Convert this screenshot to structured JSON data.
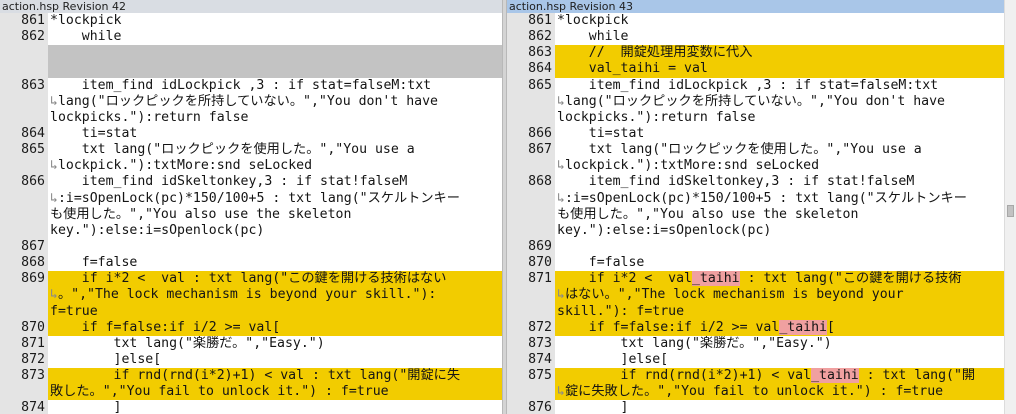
{
  "left_pane": {
    "title": "action.hsp Revision 42",
    "lines": [
      {
        "num": "861",
        "text": "*lockpick",
        "wrap": false,
        "hl": false,
        "gap": false
      },
      {
        "num": "862",
        "text": "    while",
        "wrap": false,
        "hl": false,
        "gap": false
      },
      {
        "num": "",
        "text": "",
        "wrap": false,
        "hl": false,
        "gap": true
      },
      {
        "num": "",
        "text": "",
        "wrap": false,
        "hl": false,
        "gap": true
      },
      {
        "num": "863",
        "text": "    item_find idLockpick ,3 : if stat=falseM:txt",
        "wrap": false,
        "hl": false,
        "gap": false
      },
      {
        "num": "",
        "text": "lang(\"ロックピックを所持していない。\",\"You don't have",
        "wrap": true,
        "hl": false,
        "gap": false
      },
      {
        "num": "",
        "text": "lockpicks.\"):return false",
        "wrap": false,
        "hl": false,
        "gap": false
      },
      {
        "num": "864",
        "text": "    ti=stat",
        "wrap": false,
        "hl": false,
        "gap": false
      },
      {
        "num": "865",
        "text": "    txt lang(\"ロックピックを使用した。\",\"You use a",
        "wrap": false,
        "hl": false,
        "gap": false
      },
      {
        "num": "",
        "text": "lockpick.\"):txtMore:snd seLocked",
        "wrap": true,
        "hl": false,
        "gap": false
      },
      {
        "num": "866",
        "text": "    item_find idSkeltonkey,3 : if stat!falseM",
        "wrap": false,
        "hl": false,
        "gap": false
      },
      {
        "num": "",
        "text": ":i=sOpenLock(pc)*150/100+5 : txt lang(\"スケルトンキー",
        "wrap": true,
        "hl": false,
        "gap": false
      },
      {
        "num": "",
        "text": "も使用した。\",\"You also use the skeleton",
        "wrap": false,
        "hl": false,
        "gap": false
      },
      {
        "num": "",
        "text": "key.\"):else:i=sOpenlock(pc)",
        "wrap": false,
        "hl": false,
        "gap": false
      },
      {
        "num": "867",
        "text": "",
        "wrap": false,
        "hl": false,
        "gap": false
      },
      {
        "num": "868",
        "text": "    f=false",
        "wrap": false,
        "hl": false,
        "gap": false
      },
      {
        "num": "869",
        "text": "    if i*2 <  val : txt lang(\"この鍵を開ける技術はない",
        "wrap": false,
        "hl": true,
        "gap": false
      },
      {
        "num": "",
        "text": "。\",\"The lock mechanism is beyond your skill.\"):",
        "wrap": true,
        "hl": true,
        "gap": false
      },
      {
        "num": "",
        "text": "f=true",
        "wrap": false,
        "hl": true,
        "gap": false
      },
      {
        "num": "870",
        "text": "    if f=false:if i/2 >= val[",
        "wrap": false,
        "hl": true,
        "gap": false
      },
      {
        "num": "871",
        "text": "        txt lang(\"楽勝だ。\",\"Easy.\")",
        "wrap": false,
        "hl": false,
        "gap": false
      },
      {
        "num": "872",
        "text": "        ]else[",
        "wrap": false,
        "hl": false,
        "gap": false
      },
      {
        "num": "873",
        "text": "        if rnd(rnd(i*2)+1) < val : txt lang(\"開錠に失",
        "wrap": false,
        "hl": true,
        "gap": false
      },
      {
        "num": "",
        "text": "敗した。\",\"You fail to unlock it.\") : f=true",
        "wrap": false,
        "hl": true,
        "gap": false
      },
      {
        "num": "874",
        "text": "        ]",
        "wrap": false,
        "hl": false,
        "gap": false
      }
    ]
  },
  "right_pane": {
    "title": "action.hsp Revision 43",
    "lines": [
      {
        "num": "861",
        "text": "*lockpick",
        "wrap": false,
        "hl": false,
        "gap": false
      },
      {
        "num": "862",
        "text": "    while",
        "wrap": false,
        "hl": false,
        "gap": false
      },
      {
        "num": "863",
        "text": "    //  開錠処理用変数に代入",
        "wrap": false,
        "hl": true,
        "gap": false
      },
      {
        "num": "864",
        "text": "    val_taihi = val",
        "wrap": false,
        "hl": true,
        "gap": false
      },
      {
        "num": "865",
        "text": "    item_find idLockpick ,3 : if stat=falseM:txt",
        "wrap": false,
        "hl": false,
        "gap": false
      },
      {
        "num": "",
        "text": "lang(\"ロックピックを所持していない。\",\"You don't have",
        "wrap": true,
        "hl": false,
        "gap": false
      },
      {
        "num": "",
        "text": "lockpicks.\"):return false",
        "wrap": false,
        "hl": false,
        "gap": false
      },
      {
        "num": "866",
        "text": "    ti=stat",
        "wrap": false,
        "hl": false,
        "gap": false
      },
      {
        "num": "867",
        "text": "    txt lang(\"ロックピックを使用した。\",\"You use a",
        "wrap": false,
        "hl": false,
        "gap": false
      },
      {
        "num": "",
        "text": "lockpick.\"):txtMore:snd seLocked",
        "wrap": true,
        "hl": false,
        "gap": false
      },
      {
        "num": "868",
        "text": "    item_find idSkeltonkey,3 : if stat!falseM",
        "wrap": false,
        "hl": false,
        "gap": false
      },
      {
        "num": "",
        "text": ":i=sOpenLock(pc)*150/100+5 : txt lang(\"スケルトンキー",
        "wrap": true,
        "hl": false,
        "gap": false
      },
      {
        "num": "",
        "text": "も使用した。\",\"You also use the skeleton",
        "wrap": false,
        "hl": false,
        "gap": false
      },
      {
        "num": "",
        "text": "key.\"):else:i=sOpenlock(pc)",
        "wrap": false,
        "hl": false,
        "gap": false
      },
      {
        "num": "869",
        "text": "",
        "wrap": false,
        "hl": false,
        "gap": false
      },
      {
        "num": "870",
        "text": "    f=false",
        "wrap": false,
        "hl": false,
        "gap": false
      },
      {
        "num": "871",
        "pre": "    if i*2 <  val",
        "mk": "_taihi",
        "post": " : txt lang(\"この鍵を開ける技術",
        "wrap": false,
        "hl": true,
        "gap": false
      },
      {
        "num": "",
        "text": "はない。\",\"The lock mechanism is beyond your",
        "wrap": true,
        "hl": true,
        "gap": false
      },
      {
        "num": "",
        "text": "skill.\"): f=true",
        "wrap": false,
        "hl": true,
        "gap": false
      },
      {
        "num": "872",
        "pre": "    if f=false:if i/2 >= val",
        "mk": "_taihi",
        "post": "[",
        "wrap": false,
        "hl": true,
        "gap": false
      },
      {
        "num": "873",
        "text": "        txt lang(\"楽勝だ。\",\"Easy.\")",
        "wrap": false,
        "hl": false,
        "gap": false
      },
      {
        "num": "874",
        "text": "        ]else[",
        "wrap": false,
        "hl": false,
        "gap": false
      },
      {
        "num": "875",
        "pre": "        if rnd(rnd(i*2)+1) < val",
        "mk": "_taihi",
        "post": " : txt lang(\"開",
        "wrap": false,
        "hl": true,
        "gap": false
      },
      {
        "num": "",
        "text": "錠に失敗した。\",\"You fail to unlock it.\") : f=true",
        "wrap": true,
        "hl": true,
        "gap": false
      },
      {
        "num": "876",
        "text": "        ]",
        "wrap": false,
        "hl": false,
        "gap": false
      }
    ]
  },
  "wrap_glyph": "↳",
  "colors": {
    "changed_line": "#f2cc00",
    "missing_line": "#c3c3c3",
    "inline_diff": "#f0a0a0",
    "gutter": "#e4e4e4"
  }
}
